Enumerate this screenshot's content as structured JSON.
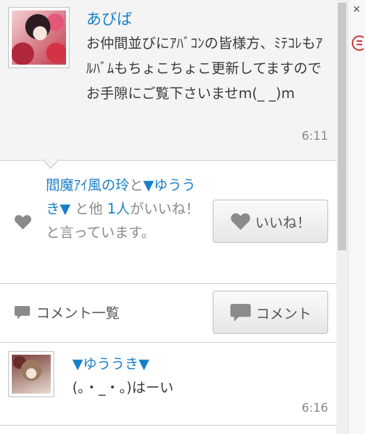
{
  "post": {
    "author": "あびば",
    "text": "お仲間並びにｱﾊﾞｺﾝの皆様方、ﾐﾃｺﾚもｱﾙﾊﾞﾑもちょこちょこ更新してますのでお手隙にご覧下さいませm(_ _)m",
    "time": "6:11"
  },
  "likes": {
    "user1": "閻魔ｱｲ風の玲",
    "conj": "と",
    "user2": "▼ゆううき▼",
    "mid": " と他 ",
    "count": "1人",
    "tail": "がいいね！と言っています。",
    "like_button": "いいね！"
  },
  "comments_section": {
    "list_label": "コメント一覧",
    "comment_button": "コメント"
  },
  "comments": [
    {
      "author": "▼ゆううき▼",
      "text": "(。・_・。)はーい",
      "time": "6:16"
    }
  ]
}
